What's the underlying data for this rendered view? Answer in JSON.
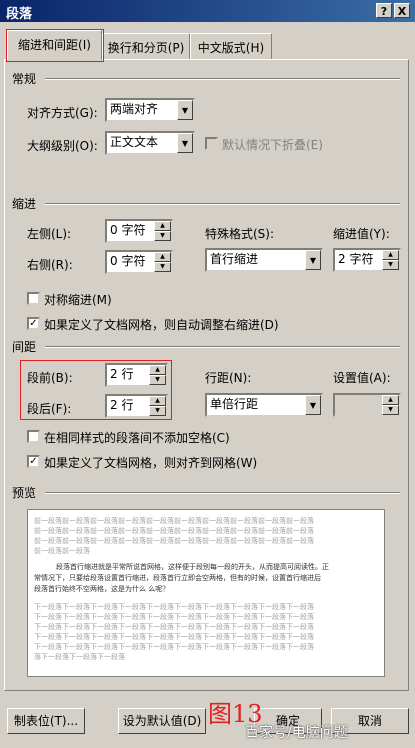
{
  "window": {
    "title": "段落",
    "help_label": "?",
    "close_label": "X"
  },
  "tabs": [
    {
      "label": "缩进和间距(I)",
      "active": true
    },
    {
      "label": "换行和分页(P)",
      "active": false
    },
    {
      "label": "中文版式(H)",
      "active": false
    }
  ],
  "general": {
    "heading": "常规",
    "alignment": {
      "label": "对齐方式(G):",
      "value": "两端对齐"
    },
    "outline": {
      "label": "大纲级别(O):",
      "value": "正文文本"
    },
    "collapse_default": {
      "label": "默认情况下折叠(E)",
      "checked": false,
      "disabled": true
    }
  },
  "indent": {
    "heading": "缩进",
    "left": {
      "label": "左侧(L):",
      "value": "0 字符"
    },
    "right": {
      "label": "右侧(R):",
      "value": "0 字符"
    },
    "special": {
      "label": "特殊格式(S):",
      "value": "首行缩进"
    },
    "by": {
      "label": "缩进值(Y):",
      "value": "2 字符"
    },
    "mirror": {
      "label": "对称缩进(M)",
      "checked": false
    },
    "auto_adjust": {
      "label": "如果定义了文档网格，则自动调整右缩进(D)",
      "checked": true
    }
  },
  "spacing": {
    "heading": "间距",
    "before": {
      "label": "段前(B):",
      "value": "2 行"
    },
    "after": {
      "label": "段后(F):",
      "value": "2 行"
    },
    "line_spacing": {
      "label": "行距(N):",
      "value": "单倍行距"
    },
    "at": {
      "label": "设置值(A):",
      "value": ""
    },
    "no_space_same_style": {
      "label": "在相同样式的段落间不添加空格(C)",
      "checked": false
    },
    "snap_grid": {
      "label": "如果定义了文档网格，则对齐到网格(W)",
      "checked": true
    }
  },
  "preview": {
    "heading": "预览",
    "before_lines": [
      "前一段落前一段落前一段落前一段落前一段落前一段落前一段落前一段落前一段落前一段落",
      "前一段落前一段落前一段落前一段落前一段落前一段落前一段落前一段落前一段落前一段落",
      "前一段落前一段落前一段落前一段落前一段落前一段落前一段落前一段落前一段落前一段落",
      "前一段落前一段落"
    ],
    "main_lines": [
      "段落首行缩进就是平常所说首网格，这样便于段别每一段的开头，从而提高可阅读性。正",
      "常情况下，只要给段落设置首行缩进，段落首行立即会空两格，但有的时候，设置首行缩进后",
      "段落首行始终不空两格，这是为什么 么呢？"
    ],
    "after_lines": [
      "下一段落下一段落下一段落下一段落下一段落下一段落下一段落下一段落下一段落下一段落",
      "下一段落下一段落下一段落下一段落下一段落下一段落下一段落下一段落下一段落下一段落",
      "下一段落下一段落下一段落下一段落下一段落下一段落下一段落下一段落下一段落下一段落",
      "下一段落下一段落下一段落下一段落下一段落下一段落下一段落下一段落下一段落下一段落",
      "下一段落下一段落下一段落下一段落下一段落下一段落下一段落下一段落下一段落下一段落",
      "落下一段落下一段落下一段落"
    ]
  },
  "buttons": {
    "tabs": "制表位(T)...",
    "set_default": "设为默认值(D)",
    "ok": "确定",
    "cancel": "取消"
  },
  "annotation": "图13",
  "watermark": "百家号/电脑问题"
}
